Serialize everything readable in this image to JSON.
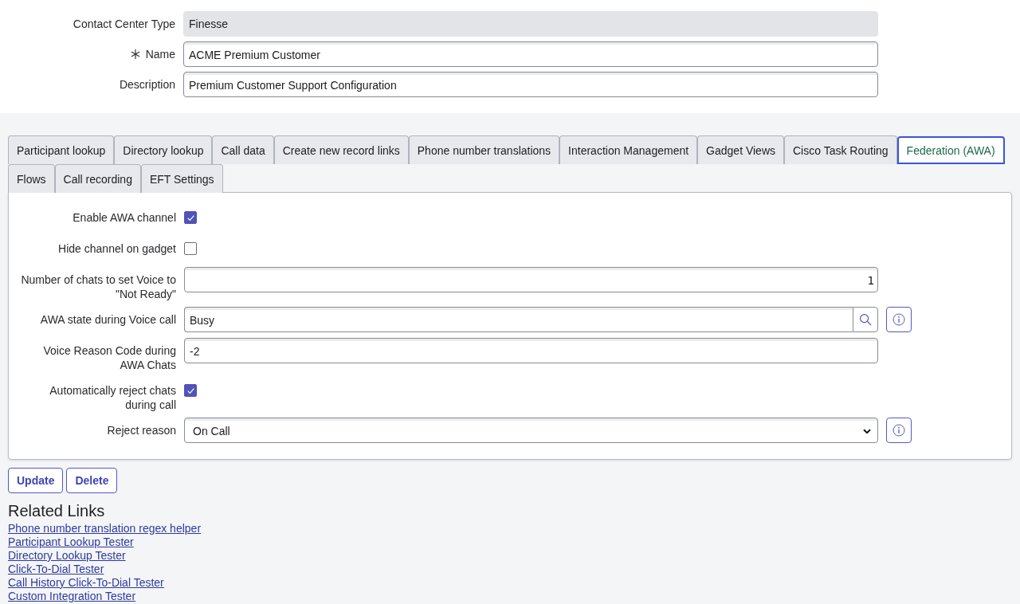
{
  "header_fields": [
    {
      "kind": "readonly",
      "label": "Contact Center Type",
      "value": "Finesse",
      "required": false
    },
    {
      "kind": "text",
      "label": "Name",
      "value": "ACME Premium Customer",
      "required": true
    },
    {
      "kind": "text",
      "label": "Description",
      "value": "Premium Customer Support Configuration",
      "required": false
    }
  ],
  "tabs": [
    {
      "label": "Participant lookup",
      "selected": false
    },
    {
      "label": "Directory lookup",
      "selected": false
    },
    {
      "label": "Call data",
      "selected": false
    },
    {
      "label": "Create new record links",
      "selected": false
    },
    {
      "label": "Phone number translations",
      "selected": false
    },
    {
      "label": "Interaction Management",
      "selected": false
    },
    {
      "label": "Gadget Views",
      "selected": false
    },
    {
      "label": "Cisco Task Routing",
      "selected": false
    },
    {
      "label": "Federation (AWA)",
      "selected": true
    },
    {
      "label": "Flows",
      "selected": false
    },
    {
      "label": "Call recording",
      "selected": false
    },
    {
      "label": "EFT Settings",
      "selected": false
    }
  ],
  "panel": {
    "rows": [
      {
        "kind": "checkbox",
        "label": "Enable AWA channel",
        "checked": true
      },
      {
        "kind": "checkbox",
        "label": "Hide channel on gadget",
        "checked": false
      },
      {
        "kind": "number",
        "label": "Number of chats to set Voice to \"Not Ready\"",
        "value": "1"
      },
      {
        "kind": "lookup",
        "label": "AWA state during Voice call",
        "value": "Busy",
        "info": true
      },
      {
        "kind": "text",
        "label": "Voice Reason Code during AWA Chats",
        "value": "-2"
      },
      {
        "kind": "checkbox",
        "label": "Automatically reject chats during call",
        "checked": true
      },
      {
        "kind": "select",
        "label": "Reject reason",
        "value": "On Call",
        "info": true
      }
    ]
  },
  "buttons": [
    "Update",
    "Delete"
  ],
  "related_links": {
    "title": "Related Links",
    "links": [
      "Phone number translation regex helper",
      "Participant Lookup Tester",
      "Directory Lookup Tester",
      "Click-To-Dial Tester",
      "Call History Click-To-Dial Tester",
      "Custom Integration Tester"
    ]
  }
}
